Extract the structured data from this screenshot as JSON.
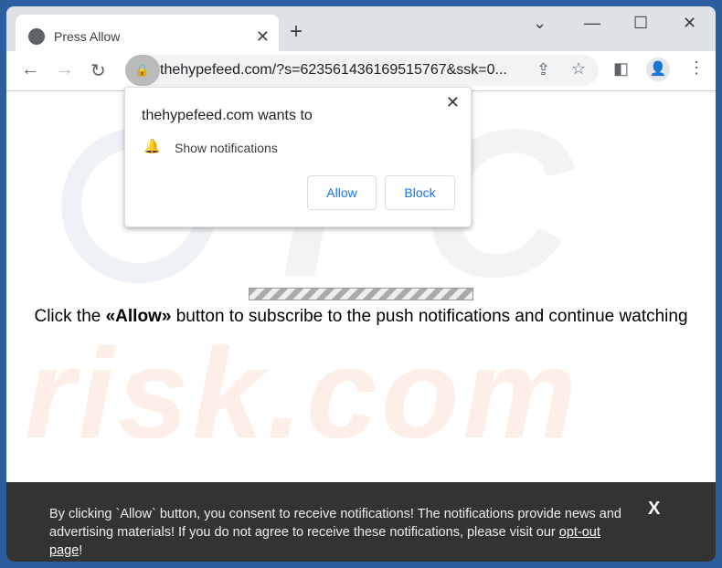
{
  "tab": {
    "title": "Press Allow"
  },
  "address_bar": {
    "url": "thehypefeed.com/?s=623561436169515767&ssk=0..."
  },
  "permission_popup": {
    "title": "thehypefeed.com wants to",
    "request": "Show notifications",
    "allow": "Allow",
    "block": "Block"
  },
  "page": {
    "msg_pre": "Click the ",
    "msg_bold": "«Allow»",
    "msg_post": " button to subscribe to the push notifications and continue watching",
    "progress_pct": 100
  },
  "footer": {
    "text": "By clicking `Allow` button, you consent to receive notifications! The notifications provide news and advertising materials! If you do not agree to receive these notifications, please visit our ",
    "link": "opt-out page",
    "end": "!",
    "close": "X"
  },
  "watermark": "risk.com"
}
